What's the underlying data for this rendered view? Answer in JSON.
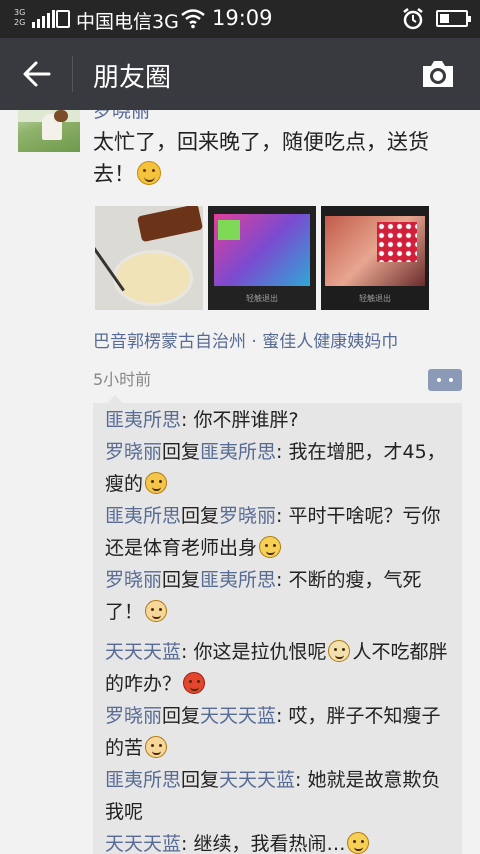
{
  "status_bar": {
    "network_top": "3G",
    "network_bottom": "2G",
    "carrier": "中国电信3G",
    "time": "19:09"
  },
  "nav": {
    "title": "朋友圈",
    "back_icon": "back-arrow-icon",
    "camera_icon": "camera-icon"
  },
  "post": {
    "author": "罗晓丽",
    "text": "太忙了，回来晚了，随便吃点，送货去！",
    "photos": [
      {
        "icon": "food-photo",
        "caption": ""
      },
      {
        "icon": "package-photo",
        "caption": "轻触退出"
      },
      {
        "icon": "package-photo",
        "caption": "轻触退出"
      }
    ],
    "location": "巴音郭楞蒙古自治州 · 蜜佳人健康姨妈巾",
    "time_ago": "5小时前"
  },
  "comments": [
    {
      "from": "匪夷所思",
      "reply_word": "",
      "to": "",
      "text": ": 你不胖谁胖?"
    },
    {
      "from": "罗晓丽",
      "reply_word": "回复",
      "to": "匪夷所思",
      "text": ": 我在增肥，才45，瘦的"
    },
    {
      "from": "匪夷所思",
      "reply_word": "回复",
      "to": "罗晓丽",
      "text": ": 平时干啥呢？亏你还是体育老师出身"
    },
    {
      "from": "罗晓丽",
      "reply_word": "回复",
      "to": "匪夷所思",
      "text": ": 不断的瘦，气死了！"
    },
    {
      "from": "天天天蓝",
      "reply_word": "",
      "to": "",
      "text": ": 你这是拉仇恨呢",
      "text2": "人不吃都胖的咋办？"
    },
    {
      "from": "罗晓丽",
      "reply_word": "回复",
      "to": "天天天蓝",
      "text": ": 哎，胖子不知瘦子的苦"
    },
    {
      "from": "匪夷所思",
      "reply_word": "回复",
      "to": "天天天蓝",
      "text": ": 她就是故意欺负我呢"
    },
    {
      "from": "天天天蓝",
      "reply_word": "",
      "to": "",
      "text": ": 继续，我看热闹…"
    }
  ],
  "colors": {
    "status_bar": "#262626",
    "nav_bar": "#393a3f",
    "name_link": "#576b95",
    "background": "#f2f2f2",
    "comment_bg": "#e6e6e6"
  }
}
